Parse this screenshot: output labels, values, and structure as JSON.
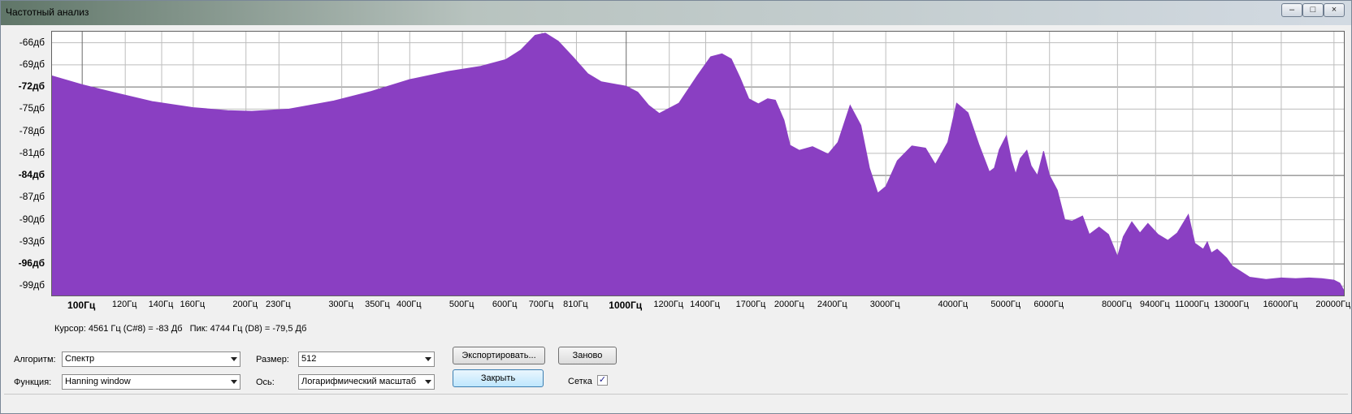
{
  "window": {
    "title": "Частотный анализ",
    "buttons": {
      "minimize": "–",
      "maximize": "□",
      "close": "×"
    }
  },
  "chart_data": {
    "type": "area",
    "title": "",
    "xlabel": "",
    "ylabel": "",
    "x_scale": "log",
    "xlim": [
      88,
      21000
    ],
    "ylim": [
      -100.5,
      -64.5
    ],
    "grid": true,
    "color": "#8a3fc2",
    "y_ticks": [
      {
        "value": -66,
        "label": "-66дб",
        "bold": false
      },
      {
        "value": -69,
        "label": "-69дб",
        "bold": false
      },
      {
        "value": -72,
        "label": "-72дб",
        "bold": true
      },
      {
        "value": -75,
        "label": "-75дб",
        "bold": false
      },
      {
        "value": -78,
        "label": "-78дб",
        "bold": false
      },
      {
        "value": -81,
        "label": "-81дб",
        "bold": false
      },
      {
        "value": -84,
        "label": "-84дб",
        "bold": true
      },
      {
        "value": -87,
        "label": "-87дб",
        "bold": false
      },
      {
        "value": -90,
        "label": "-90дб",
        "bold": false
      },
      {
        "value": -93,
        "label": "-93дб",
        "bold": false
      },
      {
        "value": -96,
        "label": "-96дб",
        "bold": true
      },
      {
        "value": -99,
        "label": "-99дб",
        "bold": false
      }
    ],
    "x_ticks": [
      {
        "value": 100,
        "label": "100Гц",
        "bold": true
      },
      {
        "value": 120,
        "label": "120Гц",
        "bold": false
      },
      {
        "value": 140,
        "label": "140Гц",
        "bold": false
      },
      {
        "value": 160,
        "label": "160Гц",
        "bold": false
      },
      {
        "value": 200,
        "label": "200Гц",
        "bold": false
      },
      {
        "value": 230,
        "label": "230Гц",
        "bold": false
      },
      {
        "value": 300,
        "label": "300Гц",
        "bold": false
      },
      {
        "value": 350,
        "label": "350Гц",
        "bold": false
      },
      {
        "value": 400,
        "label": "400Гц",
        "bold": false
      },
      {
        "value": 500,
        "label": "500Гц",
        "bold": false
      },
      {
        "value": 600,
        "label": "600Гц",
        "bold": false
      },
      {
        "value": 700,
        "label": "700Гц",
        "bold": false
      },
      {
        "value": 810,
        "label": "810Гц",
        "bold": false
      },
      {
        "value": 1000,
        "label": "1000Гц",
        "bold": true
      },
      {
        "value": 1200,
        "label": "1200Гц",
        "bold": false
      },
      {
        "value": 1400,
        "label": "1400Гц",
        "bold": false
      },
      {
        "value": 1700,
        "label": "1700Гц",
        "bold": false
      },
      {
        "value": 2000,
        "label": "2000Гц",
        "bold": false
      },
      {
        "value": 2400,
        "label": "2400Гц",
        "bold": false
      },
      {
        "value": 3000,
        "label": "3000Гц",
        "bold": false
      },
      {
        "value": 4000,
        "label": "4000Гц",
        "bold": false
      },
      {
        "value": 5000,
        "label": "5000Гц",
        "bold": false
      },
      {
        "value": 6000,
        "label": "6000Гц",
        "bold": false
      },
      {
        "value": 8000,
        "label": "8000Гц",
        "bold": false
      },
      {
        "value": 9400,
        "label": "9400Гц",
        "bold": false
      },
      {
        "value": 11000,
        "label": "11000Гц",
        "bold": false
      },
      {
        "value": 13000,
        "label": "13000Гц",
        "bold": false
      },
      {
        "value": 16000,
        "label": "16000Гц",
        "bold": false
      },
      {
        "value": 20000,
        "label": "20000Гц",
        "bold": false
      }
    ],
    "x": [
      88,
      100,
      115,
      135,
      160,
      185,
      205,
      240,
      290,
      340,
      400,
      470,
      540,
      600,
      640,
      680,
      710,
      750,
      800,
      850,
      900,
      1000,
      1050,
      1100,
      1150,
      1250,
      1350,
      1430,
      1500,
      1560,
      1620,
      1680,
      1750,
      1820,
      1880,
      1950,
      2000,
      2080,
      2200,
      2350,
      2450,
      2580,
      2700,
      2800,
      2900,
      3000,
      3150,
      3350,
      3550,
      3700,
      3900,
      4050,
      4250,
      4450,
      4650,
      4750,
      4850,
      5000,
      5100,
      5200,
      5300,
      5450,
      5550,
      5700,
      5850,
      6000,
      6200,
      6400,
      6600,
      6900,
      7100,
      7400,
      7700,
      8000,
      8200,
      8500,
      8800,
      9100,
      9500,
      9900,
      10300,
      10800,
      11100,
      11500,
      11700,
      11900,
      12200,
      12700,
      13000,
      14000,
      15000,
      16000,
      17000,
      18000,
      19000,
      20000,
      20500,
      21000
    ],
    "y": [
      -70.5,
      -71.7,
      -72.8,
      -74.0,
      -74.8,
      -75.2,
      -75.3,
      -75.0,
      -73.9,
      -72.6,
      -71.0,
      -69.9,
      -69.2,
      -68.3,
      -67.0,
      -65.0,
      -64.7,
      -65.8,
      -68.0,
      -70.2,
      -71.3,
      -71.9,
      -72.7,
      -74.5,
      -75.6,
      -74.2,
      -70.5,
      -67.9,
      -67.5,
      -68.2,
      -70.8,
      -73.6,
      -74.3,
      -73.6,
      -73.8,
      -76.5,
      -79.9,
      -80.6,
      -80.1,
      -81.1,
      -79.5,
      -74.5,
      -77.2,
      -83.0,
      -86.4,
      -85.5,
      -82.0,
      -80.0,
      -80.3,
      -82.5,
      -79.5,
      -74.2,
      -75.5,
      -79.8,
      -83.5,
      -83.0,
      -80.5,
      -78.6,
      -81.8,
      -83.8,
      -81.7,
      -80.6,
      -82.7,
      -84.0,
      -80.7,
      -84.0,
      -86.0,
      -90.0,
      -90.2,
      -89.5,
      -92.0,
      -91.0,
      -92.0,
      -95.0,
      -92.3,
      -90.3,
      -91.8,
      -90.5,
      -92.0,
      -92.8,
      -91.8,
      -89.3,
      -93.2,
      -94.0,
      -93.0,
      -94.5,
      -94.0,
      -95.2,
      -96.3,
      -97.8,
      -98.1,
      -97.9,
      -98.0,
      -97.9,
      -98.0,
      -98.2,
      -98.6,
      -100.0
    ]
  },
  "status": {
    "cursor": "Курсор: 4561 Гц (C#8) = -83 Дб",
    "peak": "Пик: 4744 Гц (D8) = -79,5 Дб"
  },
  "controls": {
    "algorithm_label": "Алгоритм:",
    "algorithm_value": "Спектр",
    "function_label": "Функция:",
    "function_value": "Hanning window",
    "size_label": "Размер:",
    "size_value": "512",
    "axis_label": "Ось:",
    "axis_value": "Логарифмический масштаб",
    "export_button": "Экспортировать...",
    "reset_button": "Заново",
    "close_button": "Закрыть",
    "grid_label": "Сетка",
    "grid_checked": true
  }
}
